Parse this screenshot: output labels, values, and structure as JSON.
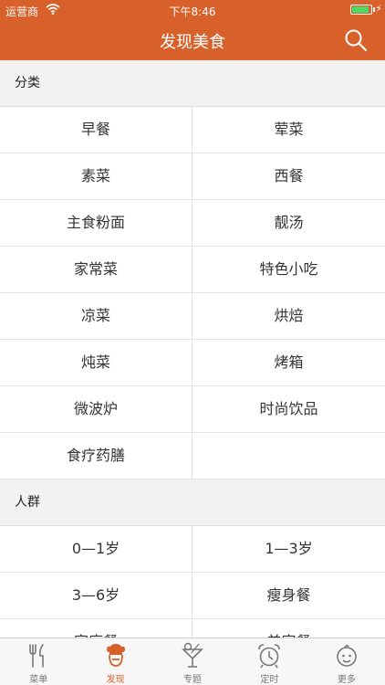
{
  "status_bar": {
    "carrier": "运营商",
    "time": "下午8:46",
    "battery_level": 0.9
  },
  "nav": {
    "title": "发现美食"
  },
  "sections": [
    {
      "title": "分类",
      "items": [
        "早餐",
        "荤菜",
        "素菜",
        "西餐",
        "主食粉面",
        "靓汤",
        "家常菜",
        "特色小吃",
        "凉菜",
        "烘焙",
        "炖菜",
        "烤箱",
        "微波炉",
        "时尚饮品",
        "食疗药膳",
        ""
      ]
    },
    {
      "title": "人群",
      "items": [
        "0—1岁",
        "1—3岁",
        "3—6岁",
        "瘦身餐",
        "家庭餐",
        "美容餐"
      ]
    }
  ],
  "tabs": [
    {
      "label": "菜单",
      "icon": "fork-knife-icon",
      "active": false
    },
    {
      "label": "发现",
      "icon": "chef-icon",
      "active": true
    },
    {
      "label": "专题",
      "icon": "cocktail-icon",
      "active": false
    },
    {
      "label": "定时",
      "icon": "alarm-clock-icon",
      "active": false
    },
    {
      "label": "更多",
      "icon": "baby-face-icon",
      "active": false
    }
  ],
  "colors": {
    "brand": "#d8602a",
    "tab_inactive": "#777777"
  }
}
